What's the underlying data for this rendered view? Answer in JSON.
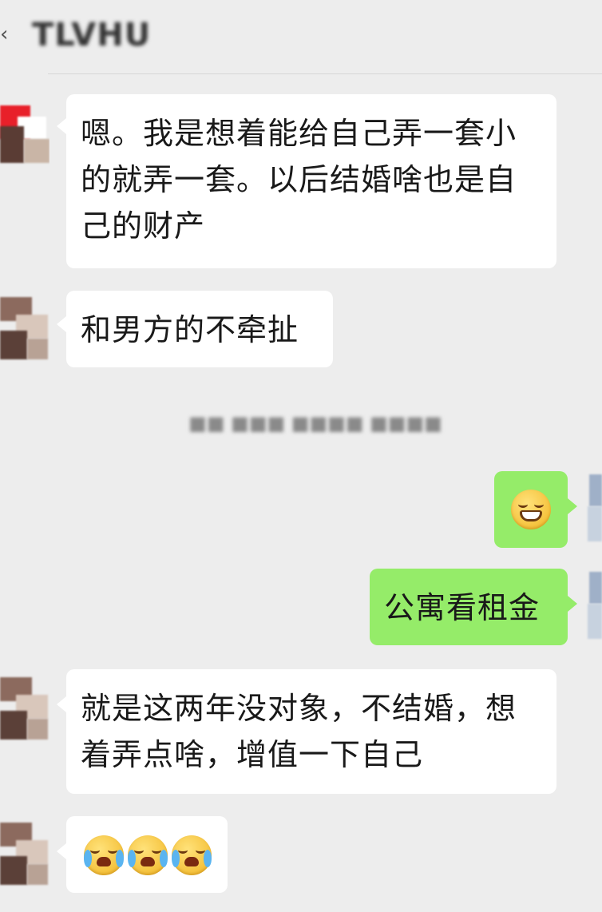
{
  "header": {
    "title": "TLVHU"
  },
  "timestamp": "■■ ■■■ ■■■■ ■■■■",
  "messages": [
    {
      "sender": "other",
      "text": "嗯。我是想着能给自己弄一套小的就弄一套。以后结婚啥也是自己的财产"
    },
    {
      "sender": "other",
      "text": "和男方的不牵扯"
    },
    {
      "sender": "self",
      "emoji": "grinning-face-emoji"
    },
    {
      "sender": "self",
      "text": "公寓看租金"
    },
    {
      "sender": "other",
      "text": "就是这两年没对象，不结婚，想着弄点啥，增值一下自己"
    },
    {
      "sender": "other",
      "emoji": [
        "crying-laughing-emoji",
        "crying-laughing-emoji",
        "crying-laughing-emoji"
      ]
    }
  ],
  "colors": {
    "background": "#ededed",
    "incoming_bubble": "#ffffff",
    "outgoing_bubble": "#95ec69",
    "text": "#191919"
  }
}
